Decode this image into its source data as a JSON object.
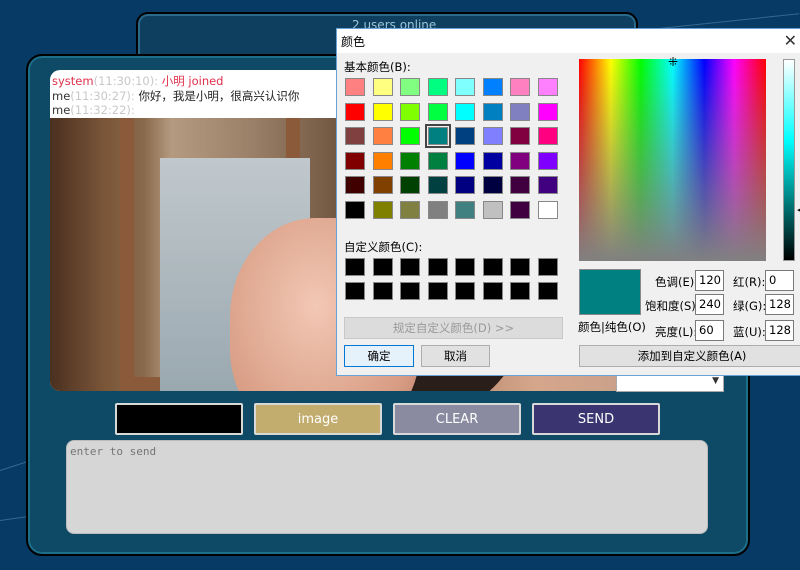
{
  "back_panel": {
    "status": "2 users online"
  },
  "chat": {
    "lines": [
      {
        "sender": "system",
        "time": "(11:30:10):",
        "text": "小明 joined"
      },
      {
        "sender": "me",
        "time": "(11:30:27):",
        "text": "你好，我是小明，很高兴认识你"
      },
      {
        "sender": "me",
        "time": "(11:32:22):",
        "text": ""
      }
    ]
  },
  "buttons": {
    "image": "image",
    "clear": "CLEAR",
    "send": "SEND"
  },
  "input": {
    "placeholder": "enter to send"
  },
  "dialog": {
    "title": "颜色",
    "basic_colors_label": "基本颜色(B):",
    "custom_colors_label": "自定义颜色(C):",
    "define_custom_button": "规定自定义颜色(D) >>",
    "ok_button": "确定",
    "cancel_button": "取消",
    "color_solid_label": "颜色|纯色(O)",
    "hue_label": "色调(E):",
    "sat_label": "饱和度(S):",
    "lum_label": "亮度(L):",
    "red_label": "红(R):",
    "green_label": "绿(G):",
    "blue_label": "蓝(U):",
    "hue": "120",
    "sat": "240",
    "lum": "60",
    "red": "0",
    "green": "128",
    "blue": "128",
    "add_custom_button": "添加到自定义颜色(A)",
    "selected_color": "#008080",
    "basic_colors": [
      [
        "#ff8080",
        "#ffff80",
        "#80ff80",
        "#00ff80",
        "#80ffff",
        "#0080ff",
        "#ff80c0",
        "#ff80ff"
      ],
      [
        "#ff0000",
        "#ffff00",
        "#80ff00",
        "#00ff40",
        "#00ffff",
        "#0080c0",
        "#8080c0",
        "#ff00ff"
      ],
      [
        "#804040",
        "#ff8040",
        "#00ff00",
        "#008080",
        "#004080",
        "#8080ff",
        "#800040",
        "#ff0080"
      ],
      [
        "#800000",
        "#ff8000",
        "#008000",
        "#008040",
        "#0000ff",
        "#0000a0",
        "#800080",
        "#8000ff"
      ],
      [
        "#400000",
        "#804000",
        "#004000",
        "#004040",
        "#000080",
        "#000040",
        "#400040",
        "#400080"
      ],
      [
        "#000000",
        "#808000",
        "#808040",
        "#808080",
        "#408080",
        "#c0c0c0",
        "#400040",
        "#ffffff"
      ]
    ],
    "custom_colors": [
      [
        "#000000",
        "#000000",
        "#000000",
        "#000000",
        "#000000",
        "#000000",
        "#000000",
        "#000000"
      ],
      [
        "#000000",
        "#000000",
        "#000000",
        "#000000",
        "#000000",
        "#000000",
        "#000000",
        "#000000"
      ]
    ]
  }
}
